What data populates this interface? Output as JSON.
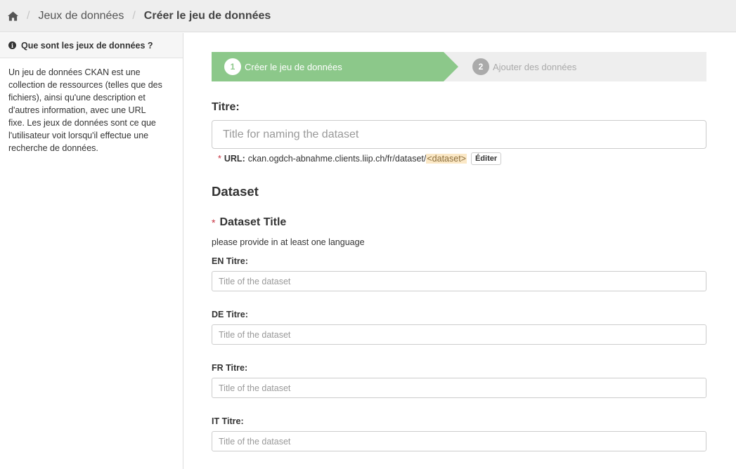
{
  "breadcrumb": {
    "home_icon": "home-icon",
    "items": [
      "Jeux de données",
      "Créer le jeu de données"
    ]
  },
  "sidebar": {
    "heading": "Que sont les jeux de données ?",
    "body": "Un jeu de données CKAN est une collection de ressources (telles que des fichiers), ainsi qu'une description et d'autres information, avec une URL fixe. Les jeux de données sont ce que l'utilisateur voit lorsqu'il effectue une recherche de données."
  },
  "stages": [
    {
      "number": "1",
      "label": "Créer le jeu de données",
      "active": true
    },
    {
      "number": "2",
      "label": "Ajouter des données",
      "active": false
    }
  ],
  "title_field": {
    "label": "Titre:",
    "placeholder": "Title for naming the dataset",
    "value": ""
  },
  "url": {
    "required_marker": "*",
    "label": "URL:",
    "prefix": "ckan.ogdch-abnahme.clients.liip.ch/fr/dataset/",
    "slug": "<dataset>",
    "edit_label": "Éditer"
  },
  "dataset_section": {
    "heading": "Dataset",
    "title_label": "Dataset Title",
    "required_marker": "*",
    "hint": "please provide in at least one language",
    "languages": [
      {
        "label": "EN Titre:",
        "placeholder": "Title of the dataset"
      },
      {
        "label": "DE Titre:",
        "placeholder": "Title of the dataset"
      },
      {
        "label": "FR Titre:",
        "placeholder": "Title of the dataset"
      },
      {
        "label": "IT Titre:",
        "placeholder": "Title of the dataset"
      }
    ]
  },
  "colors": {
    "stage_active": "#8cc88a",
    "required": "#c6303e",
    "slug_highlight": "#fbe8c6"
  }
}
